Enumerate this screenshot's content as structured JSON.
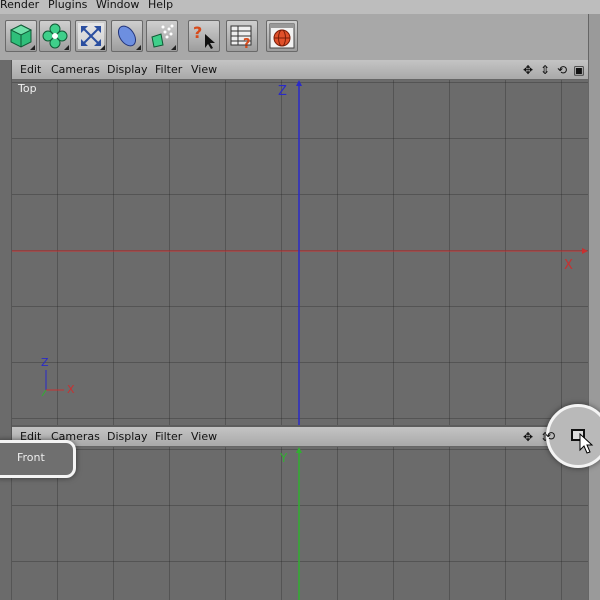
{
  "menu": {
    "items": [
      "Render",
      "Plugins",
      "Window",
      "Help"
    ]
  },
  "toolbar": {
    "icons": [
      "cube-primitive-icon",
      "nurbs-flower-icon",
      "deformer-arrows-icon",
      "generator-shape-icon",
      "particle-emitter-icon",
      "help-cursor-icon",
      "object-manager-help-icon",
      "render-view-icon"
    ]
  },
  "top_viewport": {
    "name": "Top",
    "menu": [
      "Edit",
      "Cameras",
      "Display",
      "Filter",
      "View"
    ],
    "axis_vertical_label": "Z",
    "axis_horizontal_label": "X",
    "gizmo": {
      "up": "Z",
      "right": "X"
    }
  },
  "front_viewport": {
    "name": "Front",
    "menu": [
      "Edit",
      "Cameras",
      "Display",
      "Filter",
      "View"
    ],
    "axis_vertical_label": "Y"
  },
  "colors": {
    "axis_z": "#2a2ac8",
    "axis_x": "#c83030",
    "axis_y": "#30b030",
    "viewport_bg": "#6b6b6b",
    "header_bg": "#b4b4b4"
  }
}
